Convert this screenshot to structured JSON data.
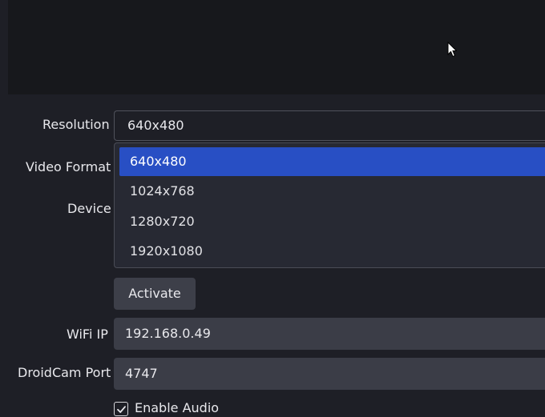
{
  "form": {
    "resolution_label": "Resolution",
    "video_format_label": "Video Format",
    "device_label": "Device",
    "resolution_value": "640x480",
    "resolution_options": [
      "640x480",
      "1024x768",
      "1280x720",
      "1920x1080"
    ],
    "activate_label": "Activate",
    "wifi_ip_label": "WiFi IP",
    "wifi_ip_value": "192.168.0.49",
    "port_label": "DroidCam Port",
    "port_value": "4747",
    "enable_audio_label": "Enable Audio",
    "enable_audio_checked": true
  },
  "colors": {
    "background": "#1e1f26",
    "preview": "#17181c",
    "selection": "#284fc4",
    "field": "#3b3d47"
  },
  "icons": {
    "cursor": "mouse-pointer-icon",
    "checkbox": "checkmark-icon"
  }
}
